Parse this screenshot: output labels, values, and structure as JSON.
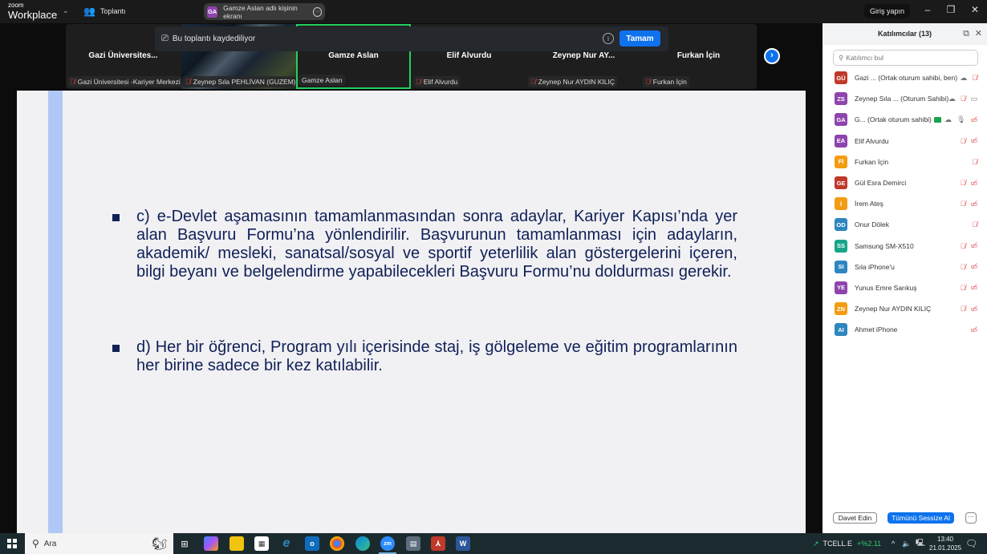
{
  "titlebar": {
    "logo_top": "zoom",
    "logo_bottom": "Workplace",
    "meeting_label": "Toplantı",
    "share_initials": "GA",
    "share_label": "Gamze Aslan adlı kişinin ekranı",
    "login_label": "Giriş yapın"
  },
  "banner": {
    "text": "Bu toplantı kaydediliyor",
    "ok_label": "Tamam"
  },
  "video_tiles": [
    {
      "name": "Gazi  Üniversites...",
      "label": "Gazi Üniversitesi -Kariyer Merkezi",
      "muted": true
    },
    {
      "name": "",
      "label": "Zeynep Sıla PEHLİVAN (GUZEM)",
      "muted": true
    },
    {
      "name": "Gamze Aslan",
      "label": "Gamze Aslan",
      "muted": false,
      "active": true
    },
    {
      "name": "Elif Alvurdu",
      "label": "Elif Alvurdu",
      "muted": true
    },
    {
      "name": "Zeynep  Nur  AY...",
      "label": "Zeynep Nur AYDIN KILIÇ",
      "muted": true
    },
    {
      "name": "Furkan İçin",
      "label": "Furkan İçin",
      "muted": true
    }
  ],
  "slide": {
    "bullets": [
      "c) e-Devlet aşamasının tamamlanmasından sonra adaylar, Kariyer Kapısı’nda yer alan Başvuru Formu’na yönlendirilir. Başvurunun tamamlanması için adayların, akademik/ mesleki, sanatsal/sosyal ve sportif yeterlilik alan göstergelerini içeren, bilgi beyanı ve belgelendirme yapabilecekleri Başvuru Formu’nu doldurması gerekir.",
      "d) Her bir öğrenci, Program yılı içerisinde staj, iş gölgeleme ve eğitim programlarının her birine sadece bir kez katılabilir."
    ]
  },
  "participants": {
    "title": "Katılımcılar (13)",
    "search_placeholder": "Katılımcı bul",
    "list": [
      {
        "initials": "GÜ",
        "color": "#c0392b",
        "name": "Gazi ...  (Ortak oturum sahibi, ben)",
        "icons": [
          "cloud",
          "mic-off"
        ]
      },
      {
        "initials": "ZS",
        "color": "#8e44ad",
        "name": "Zeynep Sıla ... (Oturum Sahibi)",
        "icons": [
          "cloud",
          "mic-off",
          "video"
        ]
      },
      {
        "initials": "GA",
        "color": "#8e44ad",
        "name": "G...  (Ortak oturum sahibi)",
        "sharing": true,
        "icons": [
          "cloud",
          "mic",
          "video-off"
        ]
      },
      {
        "initials": "EA",
        "color": "#8e44ad",
        "name": "Elif Alvurdu",
        "icons": [
          "mic-off",
          "video-off"
        ]
      },
      {
        "initials": "Fİ",
        "color": "#f39c12",
        "name": "Furkan İçin",
        "icons": [
          "mic-off"
        ]
      },
      {
        "initials": "GE",
        "color": "#c0392b",
        "name": "Gül Esra Demirci",
        "icons": [
          "mic-off",
          "video-off"
        ]
      },
      {
        "initials": "İ",
        "color": "#f39c12",
        "name": "İrem Ateş",
        "icons": [
          "mic-off",
          "video-off"
        ]
      },
      {
        "initials": "OD",
        "color": "#2e86c1",
        "name": "Onur Dölek",
        "icons": [
          "mic-off"
        ]
      },
      {
        "initials": "SS",
        "color": "#17a589",
        "name": "Samsung SM-X510",
        "icons": [
          "mic-off",
          "video-off"
        ]
      },
      {
        "initials": "SI",
        "color": "#2e86c1",
        "name": "Sıla iPhone'u",
        "icons": [
          "mic-off",
          "video-off"
        ]
      },
      {
        "initials": "YE",
        "color": "#8e44ad",
        "name": "Yunus Emre Sarıkuş",
        "icons": [
          "mic-off",
          "video-off"
        ]
      },
      {
        "initials": "ZN",
        "color": "#f39c12",
        "name": "Zeynep Nur AYDIN KILIÇ",
        "icons": [
          "mic-off",
          "video-off"
        ]
      },
      {
        "initials": "AI",
        "color": "#2e86c1",
        "name": "Ahmet iPhone",
        "icons": [
          "video-off"
        ]
      }
    ],
    "invite_label": "Davet Edin",
    "mute_all_label": "Tümünü Sessize Al",
    "more_label": "···"
  },
  "taskbar": {
    "search_placeholder": "Ara",
    "apps": [
      "task-view",
      "copilot",
      "file-explorer",
      "store",
      "internet-explorer",
      "outlook",
      "chrome",
      "edge",
      "zoom",
      "calculator",
      "acrobat",
      "word"
    ],
    "zoom_label": "zm",
    "stock_name": "TCELL.E",
    "stock_change": "+%2.11",
    "time": "13:40",
    "date": "21.01.2025"
  }
}
